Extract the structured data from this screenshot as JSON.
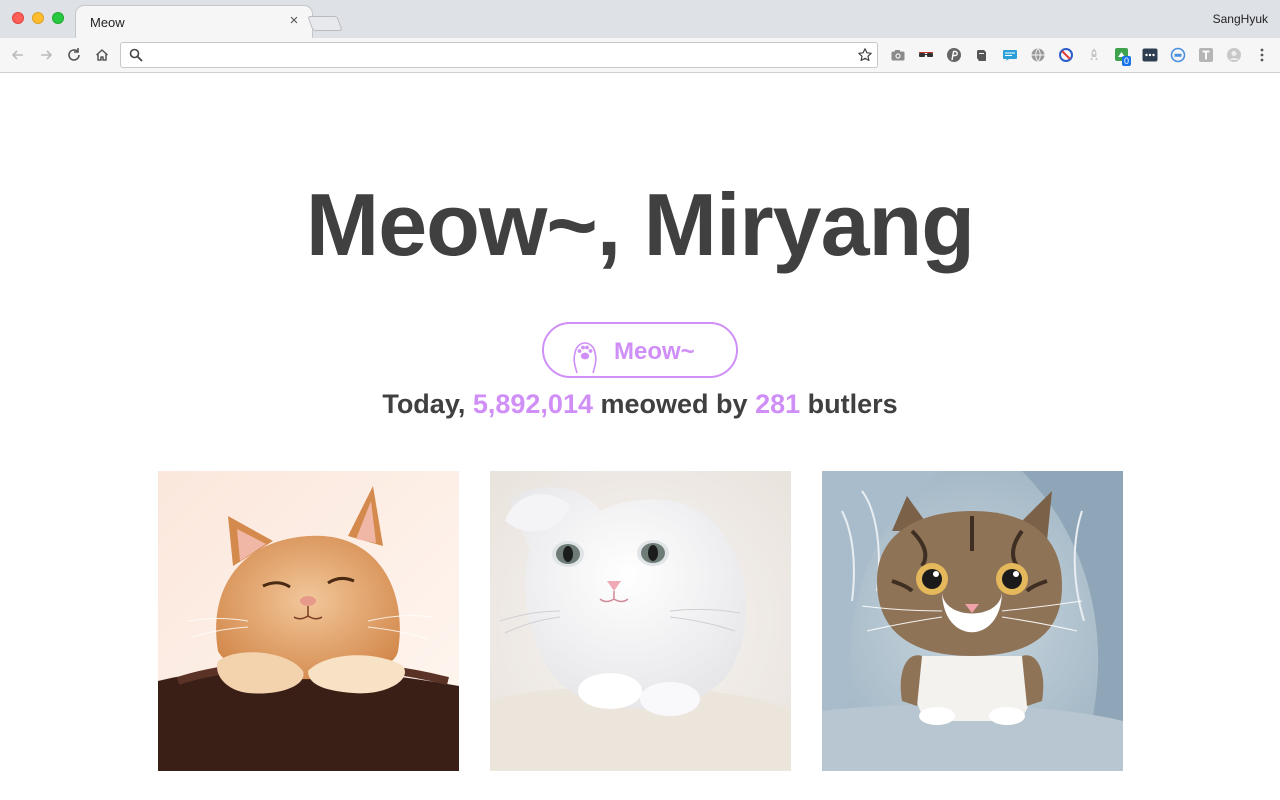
{
  "browser": {
    "tab_title": "Meow",
    "profile_name": "SangHyuk",
    "address_value": "",
    "extension_badge": "0"
  },
  "page": {
    "headline": "Meow~, Miryang",
    "meow_button_label": "Meow~",
    "stats": {
      "prefix": "Today,",
      "meow_count": "5,892,014",
      "middle": "meowed by",
      "butler_count": "281",
      "suffix": "butlers"
    },
    "cats": [
      {
        "icon": "orange-tabby-cat-photo"
      },
      {
        "icon": "white-kitten-photo"
      },
      {
        "icon": "tabby-cat-in-tunnel-photo"
      }
    ]
  },
  "colors": {
    "accent": "#cf8ff7",
    "text": "#404040"
  }
}
